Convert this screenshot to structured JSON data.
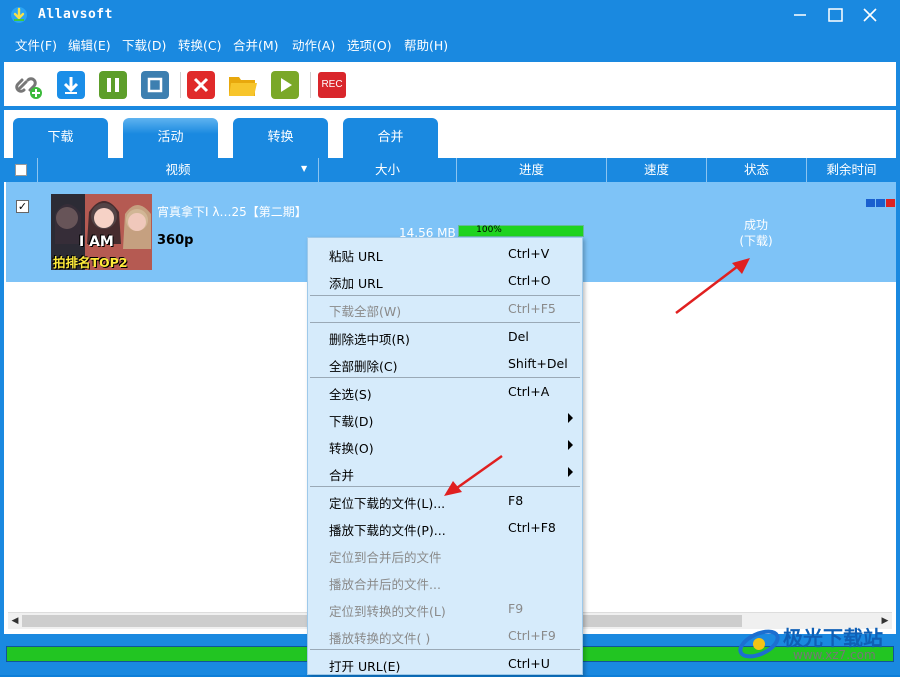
{
  "app": {
    "title": "Allavsoft"
  },
  "menu": [
    "文件(F)",
    "编辑(E)",
    "下载(D)",
    "转换(C)",
    "合并(M)",
    "动作(A)",
    "选项(O)",
    "帮助(H)"
  ],
  "toolbar": {
    "buttons": [
      "link-add-icon",
      "download-icon",
      "pause-icon",
      "stop-icon",
      "delete-icon",
      "folder-icon",
      "play-icon",
      "rec-icon"
    ],
    "rec_label": "REC"
  },
  "tabs": [
    "下载",
    "活动",
    "转换",
    "合并"
  ],
  "columns": [
    "视频",
    "大小",
    "进度",
    "速度",
    "状态",
    "剩余时间"
  ],
  "rows": [
    {
      "title": "宵真拿下I λ…25【第二期】",
      "quality": "360p",
      "size": "14.56 MB",
      "progress_text": "100%",
      "progress": 1.0,
      "status_line1": "成功",
      "status_line2": "(下载)",
      "thumb_text": "I AM",
      "thumb_caption": "拍排名TOP2"
    }
  ],
  "context_menu": [
    {
      "label": "粘贴 URL",
      "shortcut": "Ctrl+V",
      "disabled": false
    },
    {
      "label": "添加 URL",
      "shortcut": "Ctrl+O",
      "disabled": false
    },
    {
      "label": "下载全部(W)",
      "shortcut": "Ctrl+F5",
      "disabled": true
    },
    {
      "label": "删除选中项(R)",
      "shortcut": "Del",
      "disabled": false
    },
    {
      "label": "全部删除(C)",
      "shortcut": "Shift+Del",
      "disabled": false
    },
    {
      "label": "全选(S)",
      "shortcut": "Ctrl+A",
      "disabled": false
    },
    {
      "label": "下载(D)",
      "shortcut": "",
      "disabled": false
    },
    {
      "label": "转换(O)",
      "shortcut": "",
      "disabled": false
    },
    {
      "label": "合并",
      "shortcut": "",
      "disabled": false
    },
    {
      "label": "定位下载的文件(L)...",
      "shortcut": "F8",
      "disabled": false
    },
    {
      "label": "播放下载的文件(P)...",
      "shortcut": "Ctrl+F8",
      "disabled": false
    },
    {
      "label": "定位到合并后的文件",
      "shortcut": "",
      "disabled": true
    },
    {
      "label": "播放合并后的文件...",
      "shortcut": "",
      "disabled": true
    },
    {
      "label": "定位到转换的文件(L)",
      "shortcut": "F9",
      "disabled": true
    },
    {
      "label": "播放转换的文件( )",
      "shortcut": "Ctrl+F9",
      "disabled": true
    },
    {
      "label": "打开 URL(E)",
      "shortcut": "Ctrl+U",
      "disabled": false
    }
  ],
  "watermark": {
    "text": "极光下载站",
    "url": "www.xz7.com"
  },
  "colors": {
    "accent": "#1a89e0",
    "row_selected": "#7ec3f7",
    "menu_bg": "#d6ebfb",
    "progress": "#1fd31f",
    "arrow": "#e02020"
  }
}
